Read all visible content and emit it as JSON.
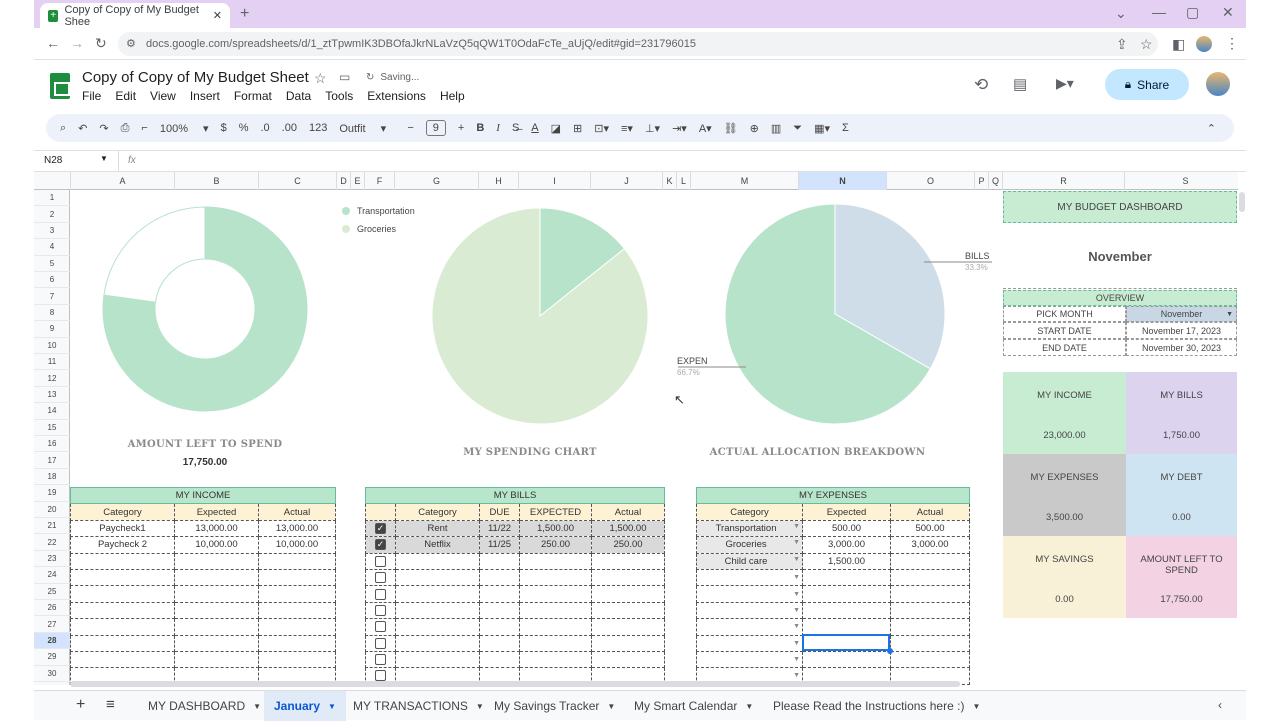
{
  "browser": {
    "tab_title": "Copy of Copy of My Budget Shee",
    "url": "docs.google.com/spreadsheets/d/1_ztTpwmIK3DBOfaJkrNLaVzQ5qQW1T0OdaFcTe_aUjQ/edit#gid=231796015"
  },
  "doc": {
    "title": "Copy of Copy of My Budget Sheet",
    "status": "Saving...",
    "share": "Share",
    "menus": [
      "File",
      "Edit",
      "View",
      "Insert",
      "Format",
      "Data",
      "Tools",
      "Extensions",
      "Help"
    ]
  },
  "toolbar": {
    "zoom": "100%",
    "currency": "$",
    "percent": "%",
    "dec_less": ".0",
    "dec_more": ".00",
    "numfmt": "123",
    "font": "Outfit",
    "size": "9",
    "bold": "B",
    "italic": "I"
  },
  "formula": {
    "cell": "N28",
    "fx": "fx"
  },
  "columns": [
    "A",
    "B",
    "C",
    "D",
    "E",
    "F",
    "G",
    "H",
    "I",
    "J",
    "K",
    "L",
    "M",
    "N",
    "O",
    "P",
    "Q",
    "R",
    "S"
  ],
  "rows": [
    "1",
    "2",
    "3",
    "4",
    "5",
    "6",
    "7",
    "8",
    "9",
    "10",
    "11",
    "12",
    "13",
    "14",
    "15",
    "16",
    "17",
    "18",
    "19",
    "20",
    "21",
    "22",
    "23",
    "24",
    "25",
    "26",
    "27",
    "28",
    "29",
    "30"
  ],
  "charts": {
    "donut_title": "AMOUNT LEFT TO SPEND",
    "donut_value": "17,750.00",
    "spending_title": "MY SPENDING CHART",
    "alloc_title": "ACTUAL ALLOCATION BREAKDOWN",
    "legend": [
      "Transportation",
      "Groceries"
    ],
    "bills_label": "BILLS",
    "bills_pct": "33.3%",
    "expen_label": "EXPEN",
    "expen_pct": "66.7%"
  },
  "chart_data": [
    {
      "type": "pie",
      "title": "AMOUNT LEFT TO SPEND",
      "values": [
        17750,
        5250
      ],
      "colors": [
        "#b7e3cb",
        "#ffffff"
      ]
    },
    {
      "type": "pie",
      "title": "MY SPENDING CHART",
      "categories": [
        "Transportation",
        "Groceries"
      ],
      "values": [
        500,
        3000
      ],
      "colors": [
        "#b7e3cb",
        "#d9ecd3"
      ]
    },
    {
      "type": "pie",
      "title": "ACTUAL ALLOCATION BREAKDOWN",
      "categories": [
        "BILLS",
        "EXPEN"
      ],
      "values": [
        33.3,
        66.7
      ],
      "colors": [
        "#cfdde8",
        "#b7e3cb"
      ]
    }
  ],
  "income": {
    "title": "MY INCOME",
    "headers": [
      "Category",
      "Expected",
      "Actual"
    ],
    "rows": [
      [
        "Paycheck1",
        "13,000.00",
        "13,000.00"
      ],
      [
        "Paycheck 2",
        "10,000.00",
        "10,000.00"
      ]
    ]
  },
  "bills": {
    "title": "MY BILLS",
    "headers": [
      "Category",
      "DUE",
      "EXPECTED",
      "Actual"
    ],
    "rows": [
      [
        "Rent",
        "11/22",
        "1,500.00",
        "1,500.00"
      ],
      [
        "Netflix",
        "11/25",
        "250.00",
        "250.00"
      ]
    ]
  },
  "expenses": {
    "title": "MY EXPENSES",
    "headers": [
      "Category",
      "Expected",
      "Actual"
    ],
    "rows": [
      [
        "Transportation",
        "500.00",
        "500.00"
      ],
      [
        "Groceries",
        "3,000.00",
        "3,000.00"
      ],
      [
        "Child care",
        "1,500.00",
        ""
      ]
    ]
  },
  "dashboard": {
    "title": "MY BUDGET DASHBOARD",
    "month": "November",
    "overview": "OVERVIEW",
    "pick_label": "PICK MONTH",
    "pick_value": "November",
    "start_label": "START DATE",
    "start_value": "November 17, 2023",
    "end_label": "END DATE",
    "end_value": "November 30, 2023",
    "cards": [
      {
        "label": "MY INCOME",
        "value": "23,000.00",
        "color": "#c8ecd2"
      },
      {
        "label": "MY BILLS",
        "value": "1,750.00",
        "color": "#dcd3ef"
      },
      {
        "label": "MY EXPENSES",
        "value": "3,500.00",
        "color": "#c9c9c9"
      },
      {
        "label": "MY DEBT",
        "value": "0.00",
        "color": "#cfe4f2"
      },
      {
        "label": "MY SAVINGS",
        "value": "0.00",
        "color": "#f8f1d8"
      },
      {
        "label": "AMOUNT LEFT TO SPEND",
        "value": "17,750.00",
        "color": "#f3d3e3"
      }
    ]
  },
  "sheet_tabs": [
    "MY DASHBOARD",
    "January",
    "MY TRANSACTIONS",
    "My Savings Tracker",
    "My Smart Calendar",
    "Please Read the Instructions here :)"
  ]
}
